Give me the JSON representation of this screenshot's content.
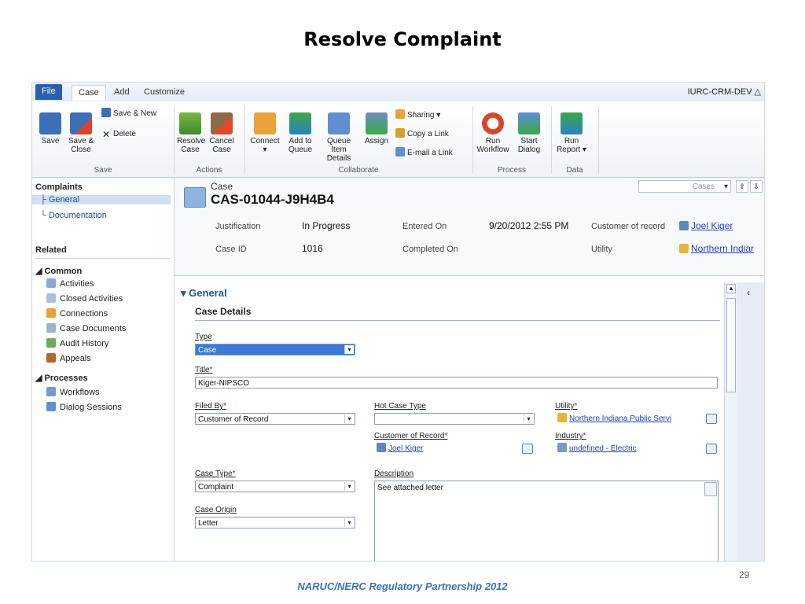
{
  "slide": {
    "title": "Resolve Complaint",
    "footer": "NARUC/NERC Regulatory Partnership 2012",
    "page_number": "29"
  },
  "ribbon": {
    "tabs": [
      "File",
      "Case",
      "Add",
      "Customize"
    ],
    "org": "IURC-CRM-DEV",
    "save": "Save",
    "save_close": "Save & Close",
    "save_new": "Save & New",
    "delete": "Delete",
    "save_group": "Save",
    "resolve_case": "Resolve Case",
    "cancel_case": "Cancel Case",
    "actions_group": "Actions",
    "connect": "Connect",
    "add_to_queue": "Add to Queue",
    "queue_item_details": "Queue Item Details",
    "assign": "Assign",
    "sharing": "Sharing",
    "copy_link": "Copy a Link",
    "email_link": "E-mail a Link",
    "collaborate_group": "Collaborate",
    "run_workflow": "Run Workflow",
    "start_dialog": "Start Dialog",
    "process_group": "Process",
    "run_report": "Run Report",
    "data_group": "Data"
  },
  "nav": {
    "complaints": "Complaints",
    "general": "General",
    "documentation": "Documentation",
    "related": "Related",
    "common": "Common",
    "activities": "Activities",
    "closed_activities": "Closed Activities",
    "connections": "Connections",
    "case_documents": "Case Documents",
    "audit_history": "Audit History",
    "appeals": "Appeals",
    "processes": "Processes",
    "workflows": "Workflows",
    "dialog_sessions": "Dialog Sessions"
  },
  "header": {
    "entity": "Case",
    "case_number": "CAS-01044-J9H4B4",
    "view_select": "Cases",
    "justification_label": "Justification",
    "justification_value": "In Progress",
    "entered_on_label": "Entered On",
    "entered_on_value": "9/20/2012 2:55 PM",
    "customer_label": "Customer of record",
    "customer_value": "Joel Kiger",
    "case_id_label": "Case ID",
    "case_id_value": "1016",
    "completed_on_label": "Completed On",
    "utility_label": "Utility",
    "utility_value": "Northern Indiar"
  },
  "form": {
    "section": "General",
    "subsection": "Case Details",
    "type_label": "Type",
    "type_value": "Case",
    "title_label": "Title",
    "title_value": "Kiger-NIPSCO",
    "filed_by_label": "Filed By",
    "filed_by_value": "Customer of Record",
    "hot_case_label": "Hot Case Type",
    "hot_case_value": "",
    "utility_label": "Utility",
    "utility_value": "Northern Indiana Public Servi",
    "customer_label": "Customer of Record",
    "customer_value": "Joel Kiger",
    "industry_label": "Industry",
    "industry_value": "undefined - Electric",
    "case_type_label": "Case Type",
    "case_type_value": "Complaint",
    "description_label": "Description",
    "description_value": "See attached letter",
    "case_origin_label": "Case Origin",
    "case_origin_value": "Letter"
  }
}
